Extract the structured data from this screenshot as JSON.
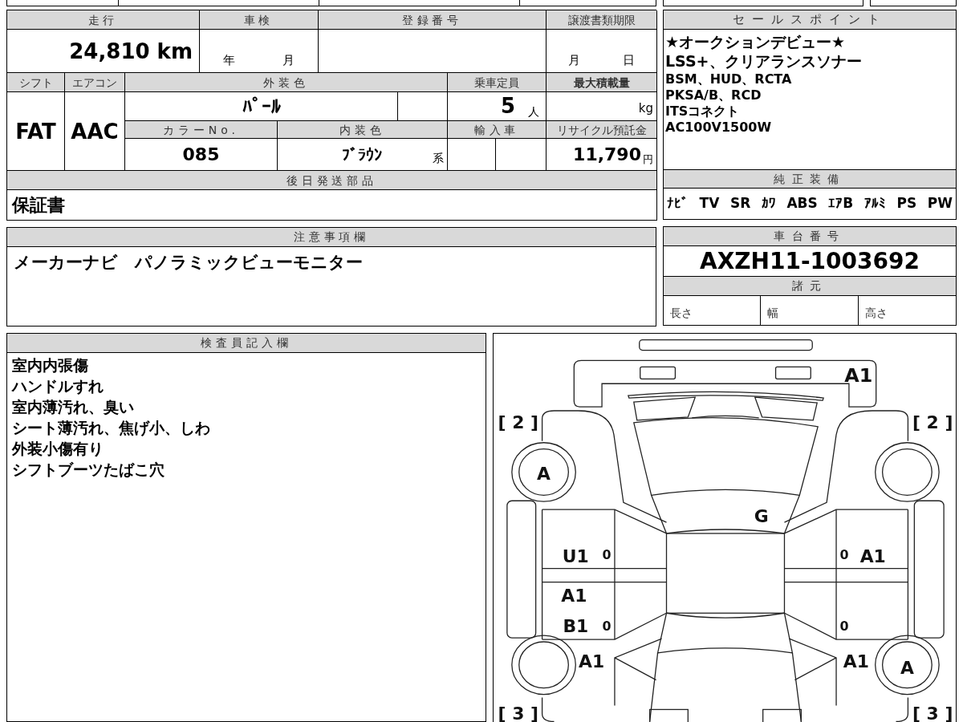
{
  "vehicle_table": {
    "mileage": {
      "label": "走行",
      "value": "24,810 km"
    },
    "inspection": {
      "label": "車検",
      "year": "年",
      "month": "月"
    },
    "registration": {
      "label": "登録番号"
    },
    "transfer_deadline": {
      "label": "譲渡書類期限",
      "month": "月",
      "day": "日"
    },
    "shift": {
      "label": "シフト",
      "value": "FAT"
    },
    "aircon": {
      "label": "エアコン",
      "value": "AAC"
    },
    "exterior_color": {
      "label": "外装色",
      "value": "ﾊﾟｰﾙ"
    },
    "capacity": {
      "label": "乗車定員",
      "value": "5",
      "unit": "人"
    },
    "max_load": {
      "label": "最大積載量",
      "unit": "kg"
    },
    "color_no": {
      "label": "カラーNo.",
      "value": "085"
    },
    "interior_color": {
      "label": "内装色",
      "value": "ﾌﾞﾗｳﾝ",
      "suffix": "系"
    },
    "import": {
      "label": "輸入車"
    },
    "recycling_fee": {
      "label": "リサイクル預託金",
      "value": "11,790",
      "unit": "円"
    },
    "later_parts": {
      "label": "後日発送部品",
      "value": "保証書"
    }
  },
  "sales_points": {
    "label": "セールスポイント",
    "lines": [
      "★オークションデビュー★",
      "LSS+、クリアランスソナー",
      "BSM、HUD、RCTA",
      "PKSA/B、RCD",
      "ITSコネクト",
      "AC100V1500W"
    ]
  },
  "standard_equipment": {
    "label": "純正装備",
    "items": [
      "ﾅﾋﾞ",
      "TV",
      "SR",
      "ｶﾜ",
      "ABS",
      "ｴｱB",
      "ｱﾙﾐ",
      "PS",
      "PW"
    ]
  },
  "notes": {
    "label": "注意事項欄",
    "text": "メーカーナビ　パノラミックビューモニター"
  },
  "chassis": {
    "label": "車台番号",
    "number": "AXZH11-1003692",
    "spec_label": "諸元",
    "specs": [
      "長さ",
      "幅",
      "高さ"
    ]
  },
  "inspector_notes": {
    "label": "検査員記入欄",
    "lines": [
      "室内内張傷",
      "ハンドルすれ",
      "室内薄汚れ、臭い",
      "シート薄汚れ、焦げ小、しわ",
      "外装小傷有り",
      "シフトブーツたばこ穴"
    ]
  },
  "damage_marks": [
    {
      "kind": "hood",
      "text": "A1"
    },
    {
      "kind": "front_left_bracket",
      "text": "[ 2 ]"
    },
    {
      "kind": "front_right_bracket",
      "text": "[ 2 ]"
    },
    {
      "kind": "front_left_wheel",
      "text": "A"
    },
    {
      "kind": "windshield",
      "text": "G"
    },
    {
      "kind": "front_left_door",
      "text": "U1"
    },
    {
      "kind": "front_left_door_aux",
      "text": "0"
    },
    {
      "kind": "front_right_door_aux",
      "text": "0"
    },
    {
      "kind": "front_right_door",
      "text": "A1"
    },
    {
      "kind": "rear_left_door_upper",
      "text": "A1"
    },
    {
      "kind": "rear_left_door",
      "text": "B1"
    },
    {
      "kind": "rear_left_door_aux",
      "text": "0"
    },
    {
      "kind": "rear_right_door_aux",
      "text": "0"
    },
    {
      "kind": "rear_left_fender",
      "text": "A1"
    },
    {
      "kind": "rear_right_fender",
      "text": "A1"
    },
    {
      "kind": "rear_right_wheel",
      "text": "A"
    },
    {
      "kind": "rear_left_bracket",
      "text": "[ 3 ]"
    },
    {
      "kind": "rear_right_bracket",
      "text": "[ 3 ]"
    }
  ]
}
